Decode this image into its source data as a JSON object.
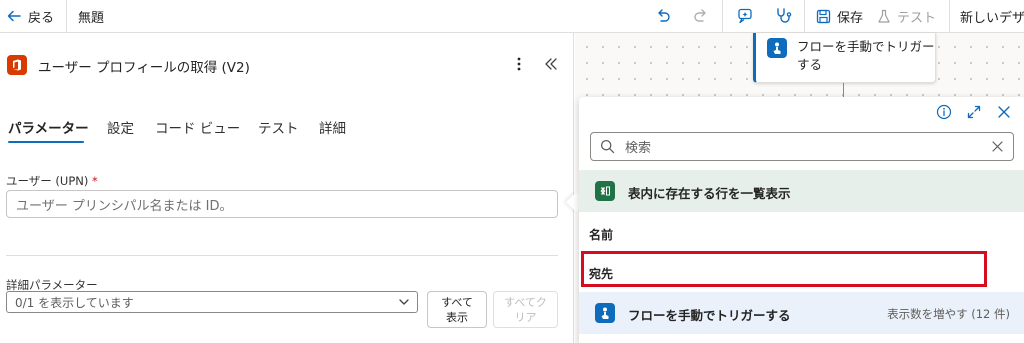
{
  "toolbar": {
    "back_label": "戻る",
    "flow_name": "無題",
    "save_label": "保存",
    "test_label": "テスト",
    "new_designer_label": "新しいデザ"
  },
  "action_panel": {
    "title": "ユーザー プロフィールの取得 (V2)",
    "tabs": [
      {
        "label": "パラメーター",
        "active": true
      },
      {
        "label": "設定",
        "active": false
      },
      {
        "label": "コード ビュー",
        "active": false
      },
      {
        "label": "テスト",
        "active": false
      },
      {
        "label": "詳細",
        "active": false
      }
    ],
    "upn_field": {
      "label": "ユーザー (UPN)",
      "required_marker": "*",
      "placeholder": "ユーザー プリンシパル名または ID。",
      "value": ""
    },
    "advanced": {
      "label": "詳細パラメーター",
      "selected": "0/1 を表示しています",
      "show_all_label": "すべて\n表示",
      "clear_all_label": "すべてク\nリア"
    }
  },
  "canvas": {
    "trigger_card_label": "フローを手動でトリガーする"
  },
  "dynamic_content": {
    "search_placeholder": "検索",
    "sections": [
      {
        "title": "表内に存在する行を一覧表示",
        "app": "excel",
        "items": [
          "名前",
          "宛先"
        ]
      },
      {
        "title": "フローを手動でトリガーする",
        "app": "manual-trigger",
        "more_label": "表示数を増やす (12 件)"
      }
    ]
  },
  "colors": {
    "accent": "#0f6cbd",
    "excel_green": "#217346",
    "office_red": "#d83b01",
    "highlight_red": "#d50d1e"
  }
}
